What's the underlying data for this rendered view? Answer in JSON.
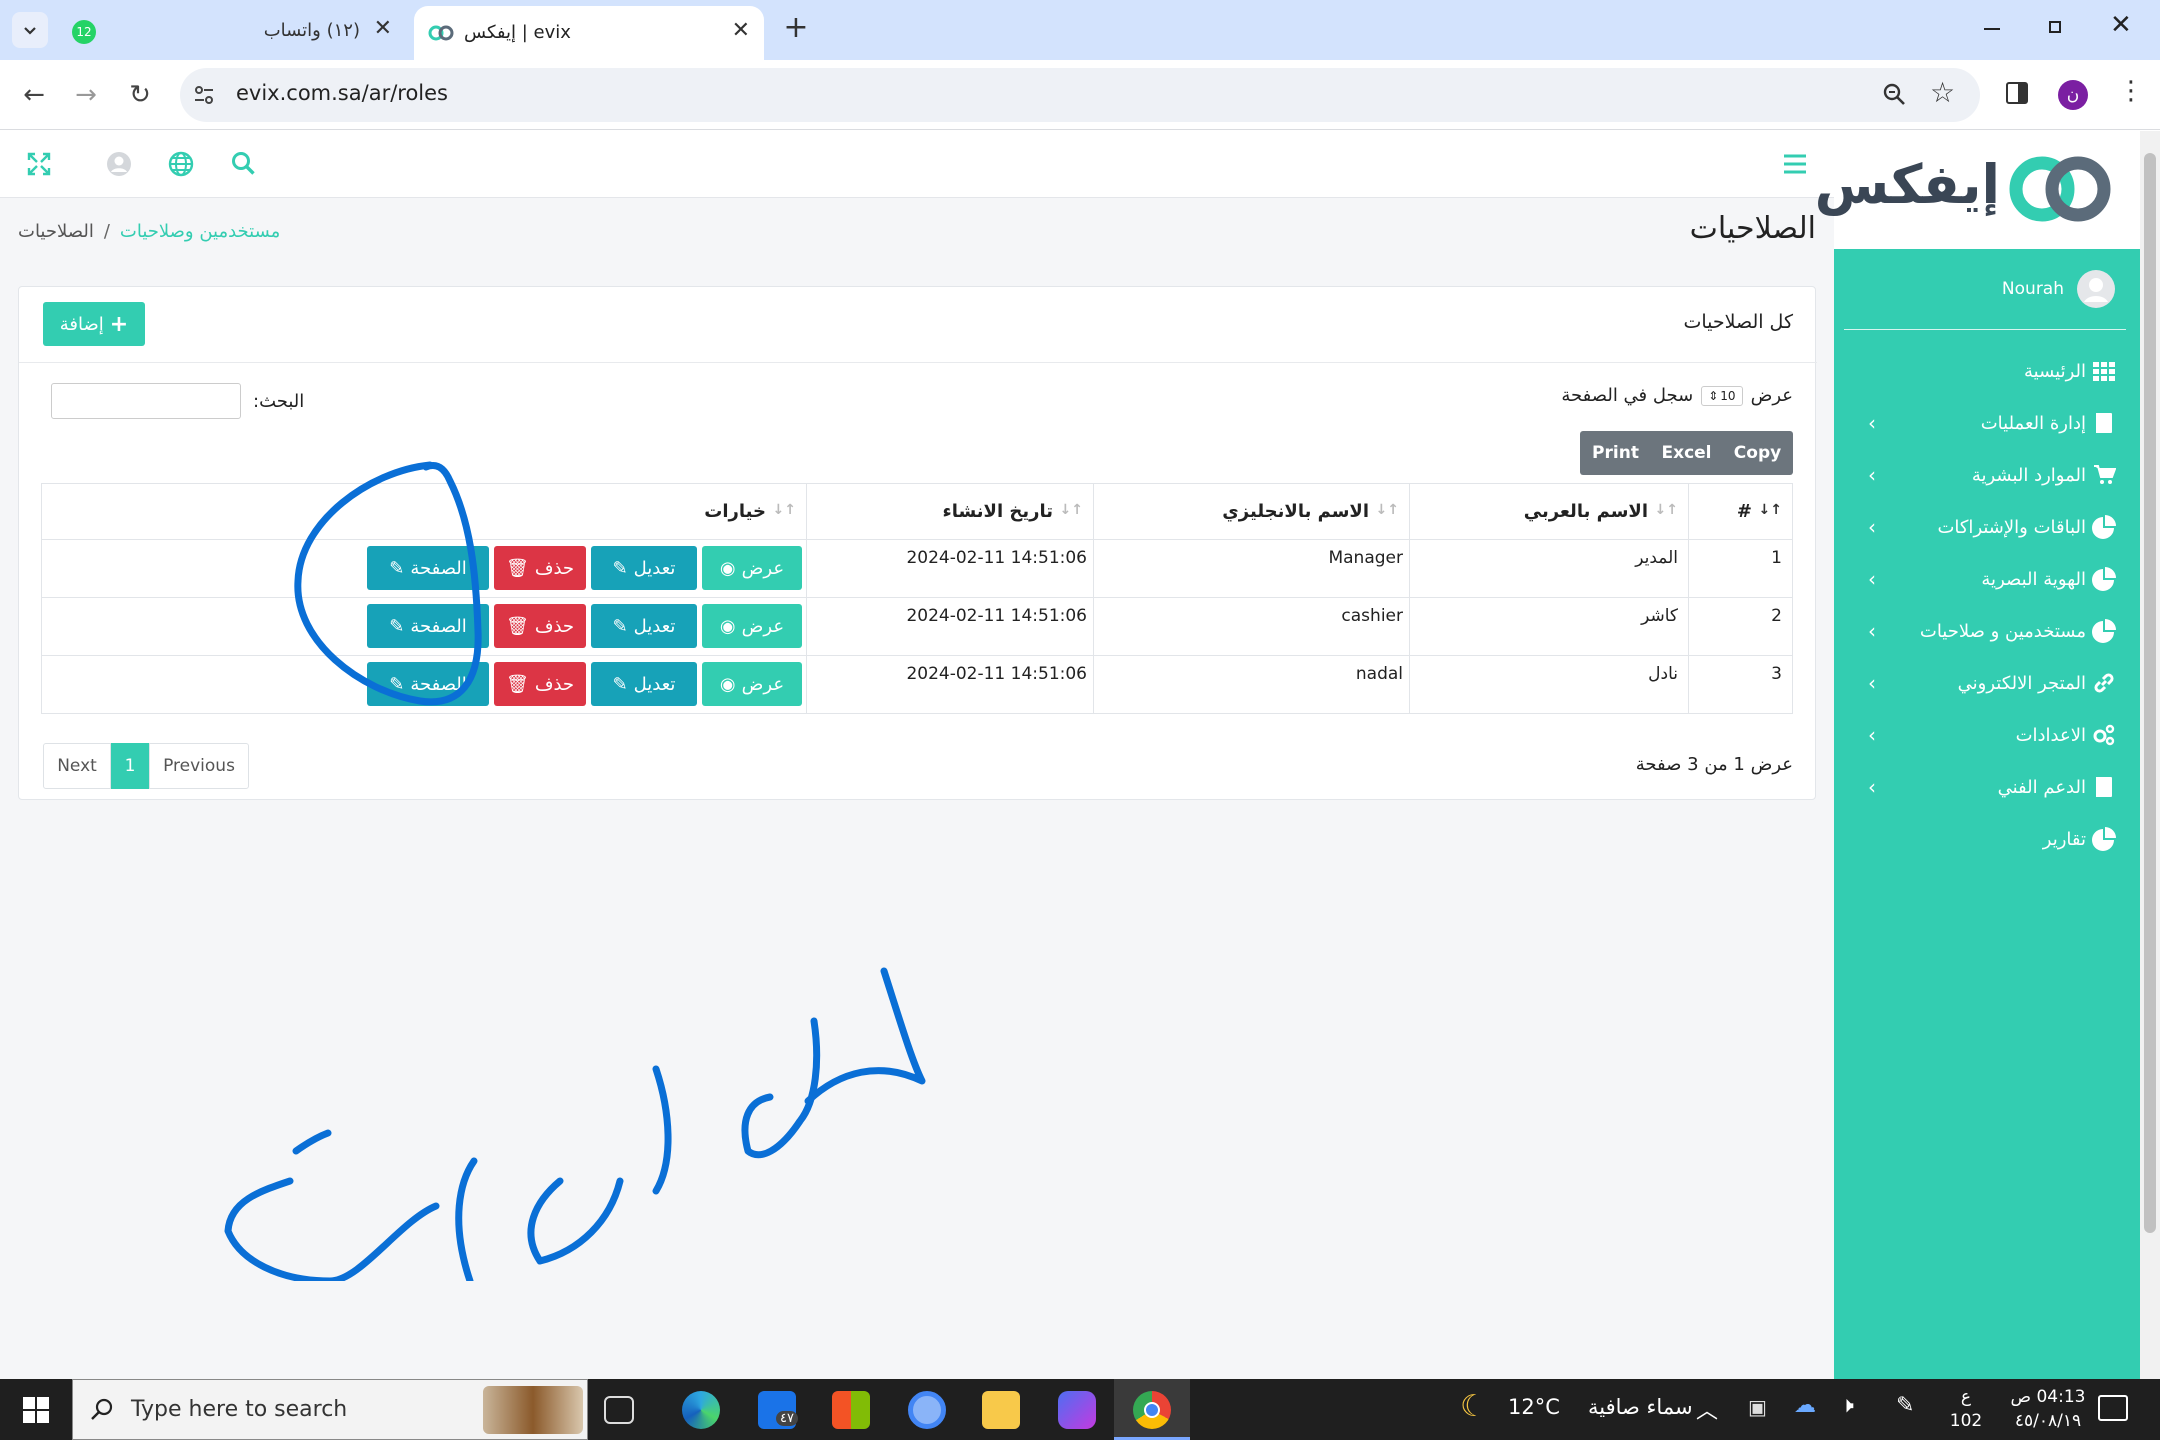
{
  "browser": {
    "tabs": [
      {
        "label": "(١٢) واتساب",
        "badge": "12"
      },
      {
        "label": "evix | إيفكس"
      }
    ],
    "url": "evix.com.sa/ar/roles",
    "profile_initial": "ن"
  },
  "sidebar": {
    "logo_text": "إيفكس",
    "user_name": "Nourah",
    "items": [
      {
        "label": "الرئيسية",
        "icon": "grid-icon"
      },
      {
        "label": "إدارة العمليات",
        "icon": "book-icon"
      },
      {
        "label": "الموارد البشرية",
        "icon": "cart-icon"
      },
      {
        "label": "الباقات والإشتراكات",
        "icon": "pie-icon"
      },
      {
        "label": "الهوية البصرية",
        "icon": "pie-icon"
      },
      {
        "label": "مستخدمين و صلاحيات",
        "icon": "pie-icon"
      },
      {
        "label": "المتجر الالكتروني",
        "icon": "link-icon"
      },
      {
        "label": "الاعدادات",
        "icon": "gears-icon"
      },
      {
        "label": "الدعم الفني",
        "icon": "book-icon"
      },
      {
        "label": "تقارير",
        "icon": "pie-icon"
      }
    ]
  },
  "header": {
    "page_title": "الصلاحيات",
    "breadcrumb_parent": "مستخدمين وصلاحيات",
    "breadcrumb_sep": "/",
    "breadcrumb_current": "الصلاحيات"
  },
  "card": {
    "title": "كل الصلاحيات",
    "add_label": "إضافة",
    "show_label": "عرض",
    "per_page_value": "10",
    "per_page_suffix": "سجل في الصفحة",
    "search_label": "البحث:",
    "export_buttons": [
      "Copy",
      "Excel",
      "Print"
    ],
    "columns": [
      "#",
      "الاسم بالعربي",
      "الاسم بالانجليزي",
      "تاريخ الانشاء",
      "خيارات"
    ],
    "rows": [
      {
        "num": "1",
        "name_ar": "المدير",
        "name_en": "Manager",
        "created": "2024-02-11 14:51:06"
      },
      {
        "num": "2",
        "name_ar": "كاشر",
        "name_en": "cashier",
        "created": "2024-02-11 14:51:06"
      },
      {
        "num": "3",
        "name_ar": "نادل",
        "name_en": "nadal",
        "created": "2024-02-11 14:51:06"
      }
    ],
    "actions": {
      "view": "عرض",
      "edit": "تعديل",
      "delete": "حذف",
      "page": "الصفحة"
    },
    "info": "عرض 1 من 3 صفحة",
    "pager": {
      "previous": "Previous",
      "current": "1",
      "next": "Next"
    }
  },
  "annotation": {
    "handwriting": "الصلاحيات"
  },
  "taskbar": {
    "search_placeholder": "Type here to search",
    "weather_temp": "12°C",
    "weather_text": "سماء صافية",
    "time": "04:13 ص",
    "date": "٤٥/٠٨/١٩",
    "lang": "ع",
    "num": "102",
    "mail_badge": "٤٧"
  },
  "colors": {
    "brand": "#33cdb1",
    "teal_btn": "#17a2b8",
    "danger": "#dc3545",
    "export_btn": "#6c757d",
    "annotation": "#0a6fd6"
  }
}
